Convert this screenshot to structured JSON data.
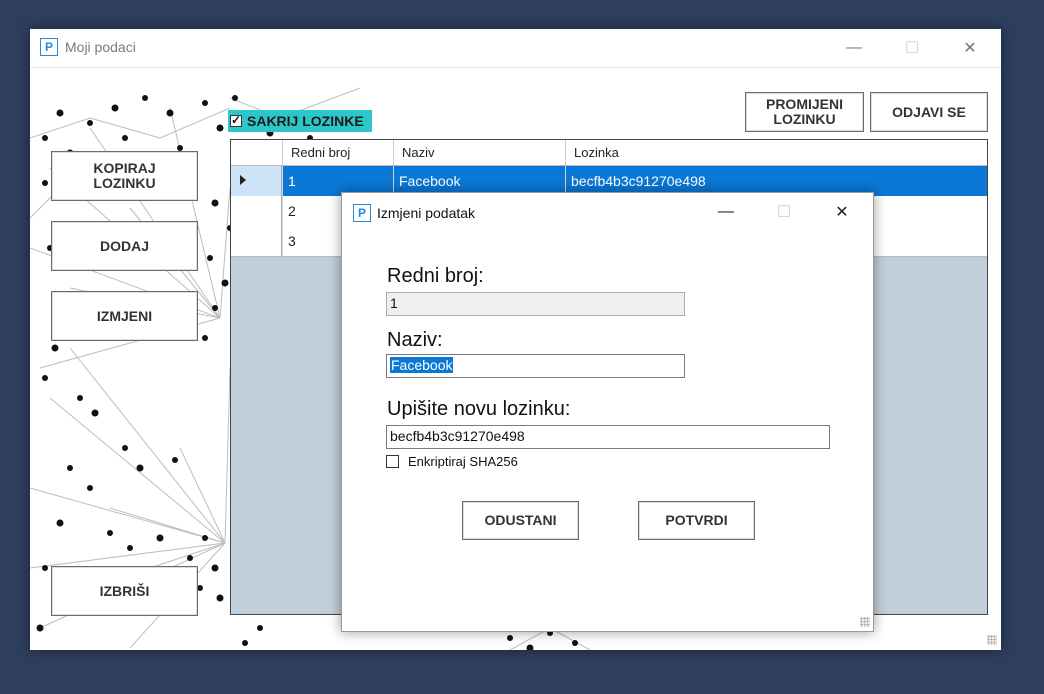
{
  "main_window": {
    "title": "Moji podaci",
    "icon_letter": "P",
    "controls": {
      "minimize": "—",
      "maximize": "☐",
      "close": "✕"
    }
  },
  "buttons": {
    "copy_password": "KOPIRAJ LOZINKU",
    "add": "DODAJ",
    "edit": "IZMJENI",
    "delete": "IZBRIŠI",
    "change_password": "PROMIJENI LOZINKU",
    "logout": "ODJAVI SE"
  },
  "hide_passwords": {
    "label": "SAKRIJ LOZINKE",
    "checked": true
  },
  "grid": {
    "columns": [
      "Redni broj",
      "Naziv",
      "Lozinka"
    ],
    "rows": [
      {
        "redni_broj": "1",
        "naziv": "Facebook",
        "lozinka": "becfb4b3c91270e498",
        "selected": true
      },
      {
        "redni_broj": "2",
        "naziv": "",
        "lozinka": "",
        "selected": false
      },
      {
        "redni_broj": "3",
        "naziv": "",
        "lozinka": "",
        "selected": false
      }
    ]
  },
  "dialog": {
    "title": "Izmjeni podatak",
    "icon_letter": "P",
    "redni_broj_label": "Redni broj:",
    "redni_broj_value": "1",
    "naziv_label": "Naziv:",
    "naziv_value": "Facebook",
    "new_password_label": "Upišite novu lozinku:",
    "new_password_value": "becfb4b3c91270e498",
    "encrypt_label": "Enkriptiraj SHA256",
    "encrypt_checked": false,
    "cancel_label": "ODUSTANI",
    "confirm_label": "POTVRDI"
  },
  "colors": {
    "desktop": "#2e3f5e",
    "selection": "#0a78d7",
    "checkbox_highlight": "#2ec7c9",
    "grid_background": "#bfcfdc"
  }
}
